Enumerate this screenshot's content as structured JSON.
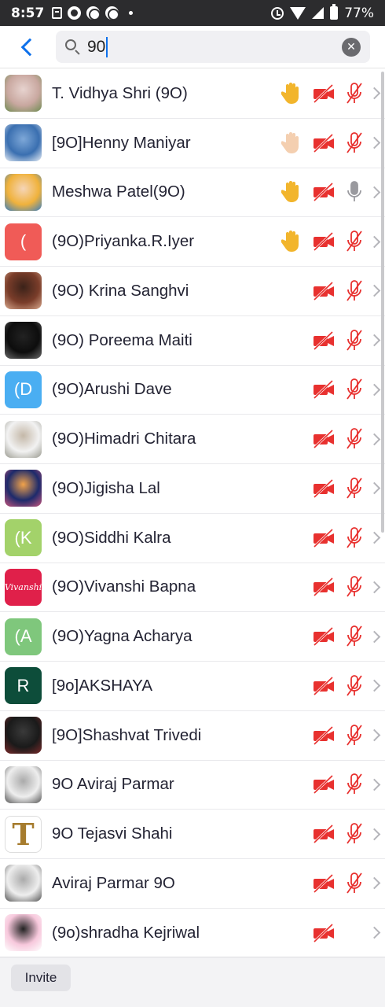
{
  "status_bar": {
    "time": "8:57",
    "battery": "77%"
  },
  "search": {
    "value": "90",
    "clear_label": "✕"
  },
  "participants": [
    {
      "name": "T. Vidhya Shri (9O)",
      "avatar": {
        "type": "photo",
        "colors": [
          "#c9a8a0",
          "#6f8b52",
          "#e7d3cf"
        ]
      },
      "hand_raised": true,
      "hand_color": "#f2b52c",
      "video_off": true,
      "mic_muted": true
    },
    {
      "name": "[9O]Henny Maniyar",
      "avatar": {
        "type": "photo",
        "colors": [
          "#3a6fb0",
          "#e8eef6",
          "#7ea8d8"
        ]
      },
      "hand_raised": true,
      "hand_color": "#f4cfb0",
      "video_off": true,
      "mic_muted": true
    },
    {
      "name": "Meshwa Patel(9O)",
      "avatar": {
        "type": "photo",
        "colors": [
          "#f0b23c",
          "#3a7fbf",
          "#f5d5b8"
        ]
      },
      "hand_raised": true,
      "hand_color": "#f2b52c",
      "video_off": true,
      "mic_muted": false
    },
    {
      "name": "(9O)Priyanka.R.Iyer",
      "avatar": {
        "type": "letter",
        "letter": "(",
        "color": "#f05b57"
      },
      "hand_raised": true,
      "hand_color": "#f2b52c",
      "video_off": true,
      "mic_muted": true
    },
    {
      "name": "(9O) Krina Sanghvi",
      "avatar": {
        "type": "photo",
        "colors": [
          "#7a3d2a",
          "#d9a98e",
          "#3b2219"
        ]
      },
      "hand_raised": false,
      "video_off": true,
      "mic_muted": true
    },
    {
      "name": "(9O) Poreema Maiti",
      "avatar": {
        "type": "photo",
        "colors": [
          "#0d0d0d",
          "#6b6b6b",
          "#222222"
        ]
      },
      "hand_raised": false,
      "video_off": true,
      "mic_muted": true
    },
    {
      "name": "(9O)Arushi Dave",
      "avatar": {
        "type": "letter",
        "letter": "(D",
        "color": "#4aaef2"
      },
      "hand_raised": false,
      "video_off": true,
      "mic_muted": true
    },
    {
      "name": "(9O)Himadri Chitara",
      "avatar": {
        "type": "photo",
        "colors": [
          "#f2f2f2",
          "#9a9a90",
          "#c4b8a8"
        ]
      },
      "hand_raised": false,
      "video_off": true,
      "mic_muted": true
    },
    {
      "name": "(9O)Jigisha Lal",
      "avatar": {
        "type": "photo",
        "colors": [
          "#1d2a6b",
          "#c9567d",
          "#f2a34a"
        ]
      },
      "hand_raised": false,
      "video_off": true,
      "mic_muted": true
    },
    {
      "name": "(9O)Siddhi Kalra",
      "avatar": {
        "type": "letter",
        "letter": "(K",
        "color": "#a3d26a"
      },
      "hand_raised": false,
      "video_off": true,
      "mic_muted": true
    },
    {
      "name": "(9O)Vivanshi Bapna",
      "avatar": {
        "type": "text",
        "letter": "Vivanshi",
        "color": "#e0204a"
      },
      "hand_raised": false,
      "video_off": true,
      "mic_muted": true
    },
    {
      "name": "(9O)Yagna Acharya",
      "avatar": {
        "type": "letter",
        "letter": "(A",
        "color": "#7fc77c"
      },
      "hand_raised": false,
      "video_off": true,
      "mic_muted": true
    },
    {
      "name": "[9o]AKSHAYA",
      "avatar": {
        "type": "letter",
        "letter": "R",
        "color": "#0d4d3a"
      },
      "hand_raised": false,
      "video_off": true,
      "mic_muted": true
    },
    {
      "name": "[9O]Shashvat Trivedi",
      "avatar": {
        "type": "photo",
        "colors": [
          "#1a1a1a",
          "#7a2a2a",
          "#3a3a3a"
        ]
      },
      "hand_raised": false,
      "video_off": true,
      "mic_muted": true
    },
    {
      "name": "9O Aviraj Parmar",
      "avatar": {
        "type": "photo",
        "colors": [
          "#eeeeee",
          "#555555",
          "#aaaaaa"
        ]
      },
      "hand_raised": false,
      "video_off": true,
      "mic_muted": true
    },
    {
      "name": "9O Tejasvi Shahi",
      "avatar": {
        "type": "text",
        "letter": "T",
        "color": "#ffffff",
        "fg": "#a67c2e"
      },
      "hand_raised": false,
      "video_off": true,
      "mic_muted": true
    },
    {
      "name": "Aviraj Parmar 9O",
      "avatar": {
        "type": "photo",
        "colors": [
          "#eeeeee",
          "#555555",
          "#aaaaaa"
        ]
      },
      "hand_raised": false,
      "video_off": true,
      "mic_muted": true
    },
    {
      "name": "(9o)shradha Kejriwal",
      "avatar": {
        "type": "photo",
        "colors": [
          "#f7c8dc",
          "#ffffff",
          "#222222"
        ]
      },
      "hand_raised": false,
      "video_off": true,
      "mic_muted": null
    }
  ],
  "footer": {
    "invite_label": "Invite"
  },
  "colors": {
    "accent": "#0e71eb",
    "muted_red": "#e8312f",
    "mic_gray": "#9a9a9f"
  }
}
